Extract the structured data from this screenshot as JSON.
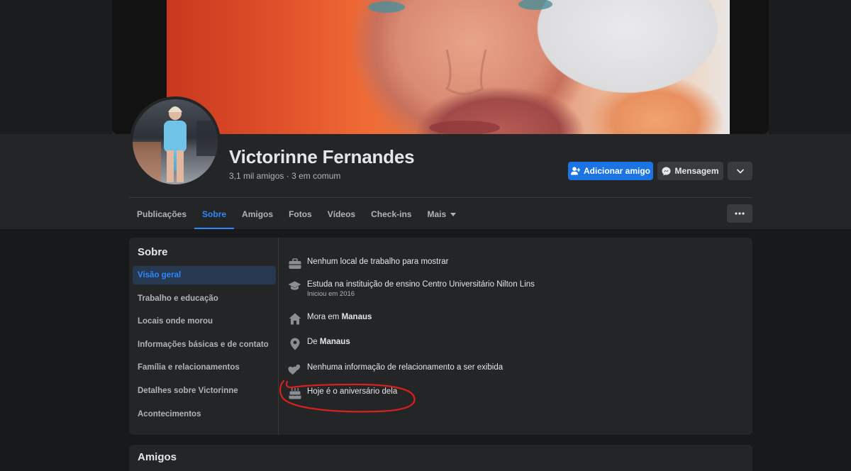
{
  "profile": {
    "name": "Victorinne Fernandes",
    "friends_count": "3,1 mil amigos",
    "mutual": "3 em comum",
    "separator": "·"
  },
  "actions": {
    "add_friend": "Adicionar amigo",
    "message": "Mensagem",
    "more_icon": "chevron-down-icon"
  },
  "tabs": [
    {
      "label": "Publicações",
      "active": false
    },
    {
      "label": "Sobre",
      "active": true
    },
    {
      "label": "Amigos",
      "active": false
    },
    {
      "label": "Fotos",
      "active": false
    },
    {
      "label": "Vídeos",
      "active": false
    },
    {
      "label": "Check-ins",
      "active": false
    },
    {
      "label": "Mais",
      "active": false
    }
  ],
  "tab_more_icon": "ellipsis-icon",
  "about": {
    "title": "Sobre",
    "nav": [
      {
        "label": "Visão geral",
        "active": true
      },
      {
        "label": "Trabalho e educação",
        "active": false
      },
      {
        "label": "Locais onde morou",
        "active": false
      },
      {
        "label": "Informações básicas e de contato",
        "active": false
      },
      {
        "label": "Família e relacionamentos",
        "active": false
      },
      {
        "label": "Detalhes sobre Victorinne",
        "active": false
      },
      {
        "label": "Acontecimentos",
        "active": false
      }
    ],
    "overview": {
      "work": "Nenhum local de trabalho para mostrar",
      "education": "Estuda na instituição de ensino Centro Universitário Nilton Lins",
      "education_since": "Iniciou em 2016",
      "lives_prefix": "Mora em",
      "lives_city": "Manaus",
      "from_prefix": "De",
      "from_city": "Manaus",
      "relationship": "Nenhuma informação de relacionamento a ser exibida",
      "birthday": "Hoje é o aniversário dela"
    }
  },
  "friends_section": {
    "title": "Amigos"
  },
  "colors": {
    "background": "#18191a",
    "card": "#242526",
    "accent": "#2d88ff",
    "primary_button": "#1b74e4",
    "annotation": "#d8211f"
  }
}
